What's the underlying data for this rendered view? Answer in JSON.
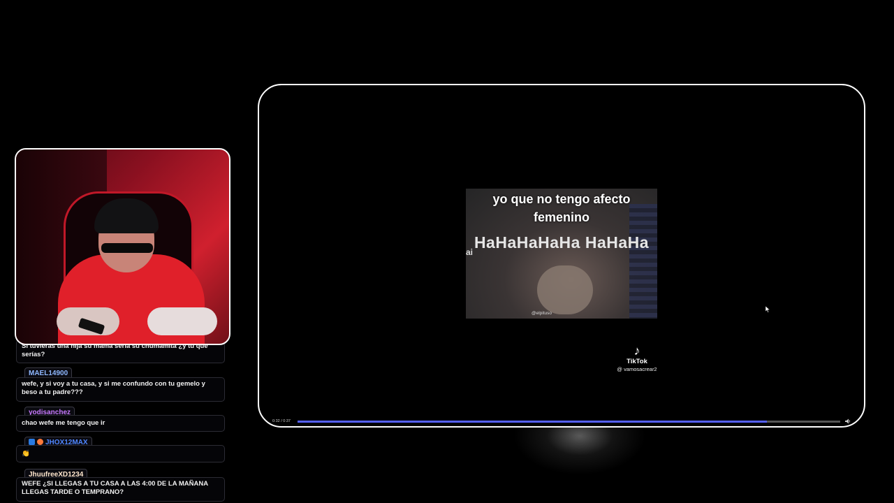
{
  "chat": {
    "messages": [
      {
        "user": "",
        "text": "Si tuvieras una hija su mamá sería su chumamita ¿y tú que serías?"
      },
      {
        "user": "MAEL14900",
        "user_color": "#8fb8ff",
        "text": "wefe, y si voy a tu casa, y si me confundo con tu gemelo y beso a tu padre???"
      },
      {
        "user": "yodisanchez",
        "user_color": "#c87aff",
        "text": "chao wefe me tengo que ir"
      },
      {
        "user": "JHOX12MAX",
        "user_color": "#4f86ff",
        "text": "👏"
      },
      {
        "user": "JhuufreeXD1234",
        "user_color": "#ffe6cc",
        "text": "WEFE ¿SI LLEGAS A TU CASA A LAS 4:00 DE LA MAÑANA LLEGAS TARDE O TEMPRANO?"
      }
    ]
  },
  "video": {
    "caption": "yo que no tengo afecto femenino",
    "laugh": "HaHaHaHaHa HaHaHa",
    "edge_text": "ai",
    "credit": "@elpituso",
    "tiktok_label": "TikTok",
    "tiktok_handle": "@ vamosacrear2",
    "timecode": "0:32 / 0:37",
    "progress_fraction": 0.865,
    "progress_color": "#5560ff"
  }
}
